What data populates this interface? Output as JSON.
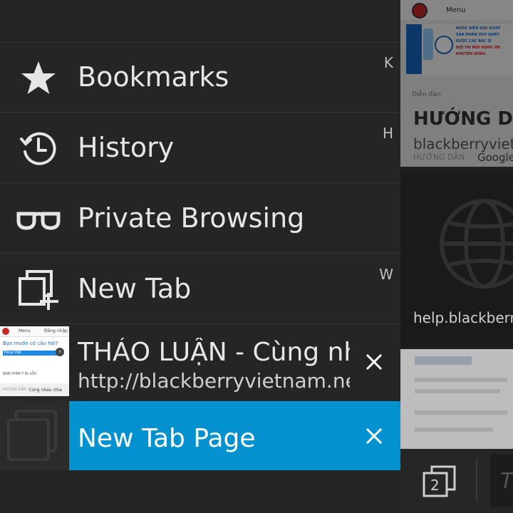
{
  "menu": {
    "items": [
      {
        "label": "Bookmarks",
        "icon": "star-icon",
        "shortcut": "K"
      },
      {
        "label": "History",
        "icon": "history-clock-icon",
        "shortcut": "H"
      },
      {
        "label": "Private Browsing",
        "icon": "glasses-icon",
        "shortcut": ""
      },
      {
        "label": "New Tab",
        "icon": "new-tab-icon",
        "shortcut": "W"
      }
    ]
  },
  "tabs": [
    {
      "title": "THẢO LUẬN - Cùng nhau chia sẻ",
      "url": "http://blackberryvietnam.net",
      "thumb": {
        "menu": "Menu",
        "login": "Đăng nhập",
        "question": "Bạn muốn có câu hỏi?",
        "sub": "Tiếng Việt",
        "link": "BÀN PHÍM Ý BỊ LỖI!",
        "footer_left": "HƯỚNG DẪN",
        "footer_right": "Cùng nhau chia"
      }
    },
    {
      "title": "New Tab Page",
      "url": ""
    }
  ],
  "right_pane": {
    "site_header_menu": "Menu",
    "banner_lines": [
      "NƯỚC BIỂN SÂU KISAT",
      "SẢN PHẨM DUY NHẤT",
      "ĐƯỢC CÁC BÁC SĨ",
      "ĐỘI TAI MŨI HỌNG VN",
      "KHUYẾN DÙNG"
    ],
    "forum_crumb": "Diễn đàn",
    "card1_title": "HƯỚNG DẪN",
    "card1_url": "blackberryvietnam",
    "card1_footer": "HƯỚNG DẪN",
    "card1_footer_right": "Google",
    "card2_url": "help.blackberry.com",
    "tab_count": "2",
    "search_hint": "T"
  },
  "colors": {
    "accent": "#0392cf",
    "background": "#252525",
    "text": "#e6e6e6"
  }
}
